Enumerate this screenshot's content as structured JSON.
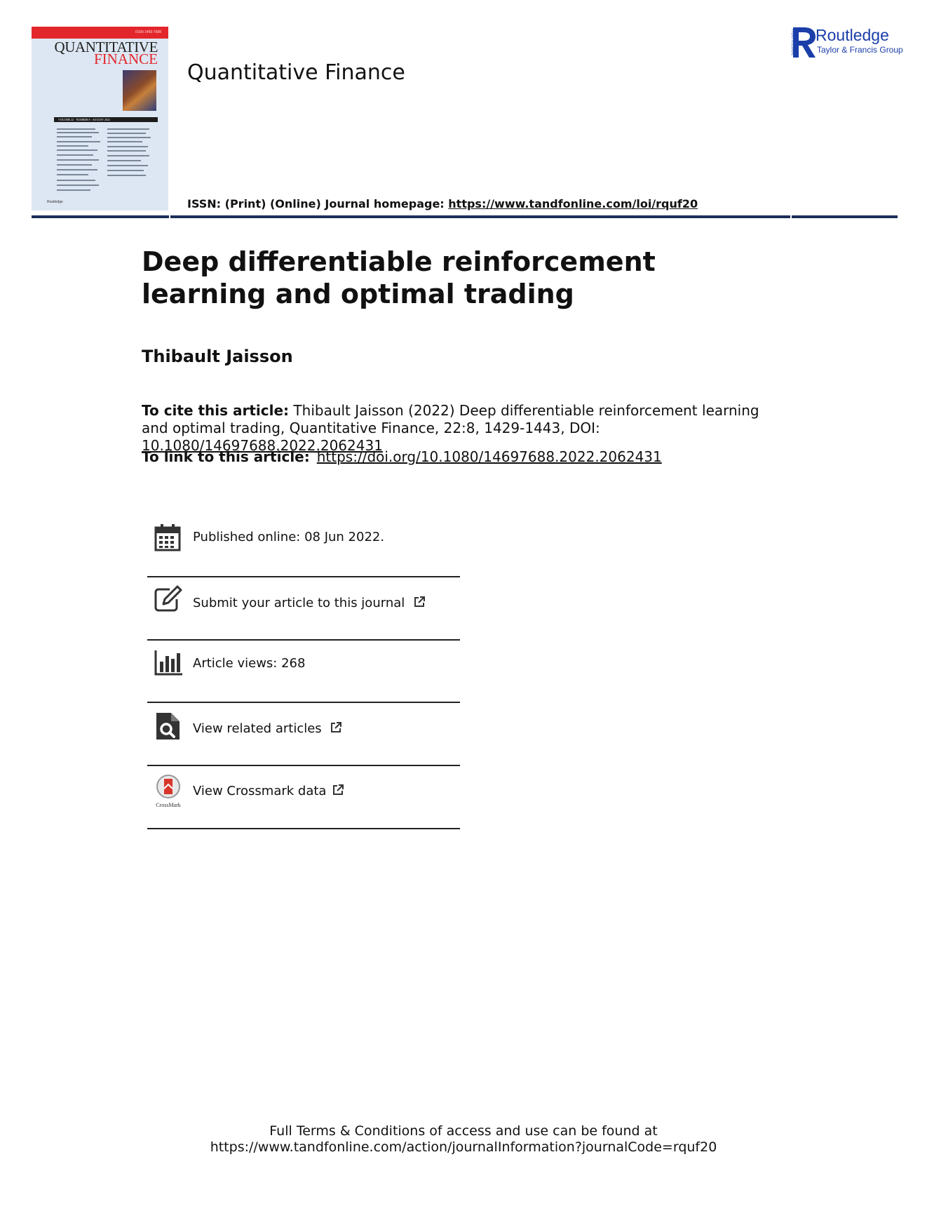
{
  "cover": {
    "issn_small": "ISSN 1469-7688",
    "title_line1": "QUANTITATIVE",
    "title_line2": "FINANCE",
    "volume": "VOLUME 22 · NUMBER 8 · AUGUST 2022",
    "publisher_small": "Routledge"
  },
  "header": {
    "journal_name": "Quantitative Finance",
    "issn_label": "ISSN: (Print) (Online) Journal homepage: ",
    "homepage_url": "https://www.tandfonline.com/loi/rquf20",
    "publisher_name": "Routledge",
    "publisher_sub": "Taylor & Francis Group",
    "publisher_vertical": "ROUTLEDGE"
  },
  "article": {
    "title": "Deep differentiable reinforcement learning and optimal trading",
    "author": "Thibault Jaisson",
    "cite_label": "To cite this article:",
    "cite_text": " Thibault Jaisson (2022) Deep differentiable reinforcement learning and optimal trading, Quantitative Finance, 22:8, 1429-1443, DOI: ",
    "doi": "10.1080/14697688.2022.2062431",
    "link_label": "To link to this article:",
    "link_url": "https://doi.org/10.1080/14697688.2022.2062431"
  },
  "info_rows": {
    "published": "Published online: 08 Jun 2022.",
    "submit": "Submit your article to this journal",
    "views": "Article views: 268",
    "related": "View related articles",
    "crossmark": "View Crossmark data",
    "crossmark_logo_text": "CrossMark"
  },
  "footer": {
    "line1": "Full Terms & Conditions of access and use can be found at",
    "line2": "https://www.tandfonline.com/action/journalInformation?journalCode=rquf20"
  },
  "colors": {
    "rule": "#1d2e5a",
    "cover_red": "#e3262b",
    "routledge_blue": "#1b3ea9",
    "cover_bg": "#dde7f3"
  }
}
